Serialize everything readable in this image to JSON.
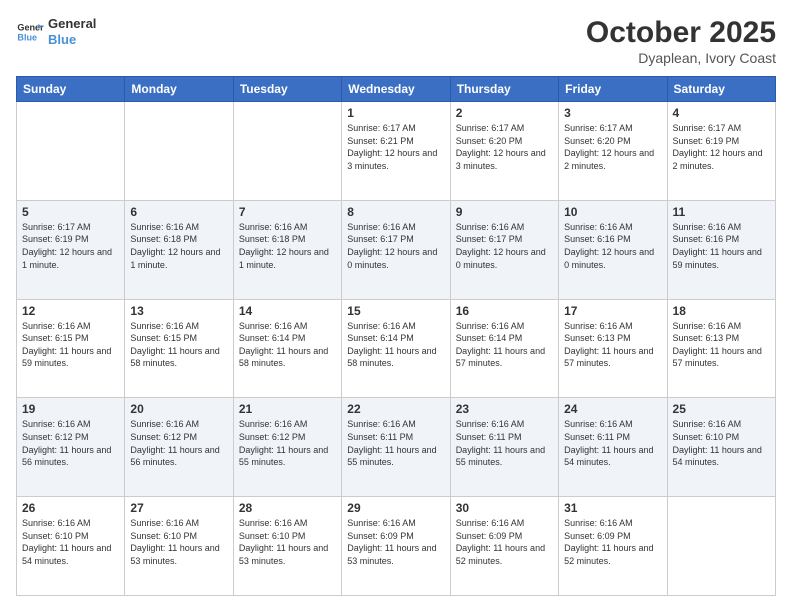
{
  "logo": {
    "line1": "General",
    "line2": "Blue"
  },
  "title": "October 2025",
  "location": "Dyaplean, Ivory Coast",
  "weekdays": [
    "Sunday",
    "Monday",
    "Tuesday",
    "Wednesday",
    "Thursday",
    "Friday",
    "Saturday"
  ],
  "rows": [
    [
      {
        "day": "",
        "info": ""
      },
      {
        "day": "",
        "info": ""
      },
      {
        "day": "",
        "info": ""
      },
      {
        "day": "1",
        "info": "Sunrise: 6:17 AM\nSunset: 6:21 PM\nDaylight: 12 hours and 3 minutes."
      },
      {
        "day": "2",
        "info": "Sunrise: 6:17 AM\nSunset: 6:20 PM\nDaylight: 12 hours and 3 minutes."
      },
      {
        "day": "3",
        "info": "Sunrise: 6:17 AM\nSunset: 6:20 PM\nDaylight: 12 hours and 2 minutes."
      },
      {
        "day": "4",
        "info": "Sunrise: 6:17 AM\nSunset: 6:19 PM\nDaylight: 12 hours and 2 minutes."
      }
    ],
    [
      {
        "day": "5",
        "info": "Sunrise: 6:17 AM\nSunset: 6:19 PM\nDaylight: 12 hours and 1 minute."
      },
      {
        "day": "6",
        "info": "Sunrise: 6:16 AM\nSunset: 6:18 PM\nDaylight: 12 hours and 1 minute."
      },
      {
        "day": "7",
        "info": "Sunrise: 6:16 AM\nSunset: 6:18 PM\nDaylight: 12 hours and 1 minute."
      },
      {
        "day": "8",
        "info": "Sunrise: 6:16 AM\nSunset: 6:17 PM\nDaylight: 12 hours and 0 minutes."
      },
      {
        "day": "9",
        "info": "Sunrise: 6:16 AM\nSunset: 6:17 PM\nDaylight: 12 hours and 0 minutes."
      },
      {
        "day": "10",
        "info": "Sunrise: 6:16 AM\nSunset: 6:16 PM\nDaylight: 12 hours and 0 minutes."
      },
      {
        "day": "11",
        "info": "Sunrise: 6:16 AM\nSunset: 6:16 PM\nDaylight: 11 hours and 59 minutes."
      }
    ],
    [
      {
        "day": "12",
        "info": "Sunrise: 6:16 AM\nSunset: 6:15 PM\nDaylight: 11 hours and 59 minutes."
      },
      {
        "day": "13",
        "info": "Sunrise: 6:16 AM\nSunset: 6:15 PM\nDaylight: 11 hours and 58 minutes."
      },
      {
        "day": "14",
        "info": "Sunrise: 6:16 AM\nSunset: 6:14 PM\nDaylight: 11 hours and 58 minutes."
      },
      {
        "day": "15",
        "info": "Sunrise: 6:16 AM\nSunset: 6:14 PM\nDaylight: 11 hours and 58 minutes."
      },
      {
        "day": "16",
        "info": "Sunrise: 6:16 AM\nSunset: 6:14 PM\nDaylight: 11 hours and 57 minutes."
      },
      {
        "day": "17",
        "info": "Sunrise: 6:16 AM\nSunset: 6:13 PM\nDaylight: 11 hours and 57 minutes."
      },
      {
        "day": "18",
        "info": "Sunrise: 6:16 AM\nSunset: 6:13 PM\nDaylight: 11 hours and 57 minutes."
      }
    ],
    [
      {
        "day": "19",
        "info": "Sunrise: 6:16 AM\nSunset: 6:12 PM\nDaylight: 11 hours and 56 minutes."
      },
      {
        "day": "20",
        "info": "Sunrise: 6:16 AM\nSunset: 6:12 PM\nDaylight: 11 hours and 56 minutes."
      },
      {
        "day": "21",
        "info": "Sunrise: 6:16 AM\nSunset: 6:12 PM\nDaylight: 11 hours and 55 minutes."
      },
      {
        "day": "22",
        "info": "Sunrise: 6:16 AM\nSunset: 6:11 PM\nDaylight: 11 hours and 55 minutes."
      },
      {
        "day": "23",
        "info": "Sunrise: 6:16 AM\nSunset: 6:11 PM\nDaylight: 11 hours and 55 minutes."
      },
      {
        "day": "24",
        "info": "Sunrise: 6:16 AM\nSunset: 6:11 PM\nDaylight: 11 hours and 54 minutes."
      },
      {
        "day": "25",
        "info": "Sunrise: 6:16 AM\nSunset: 6:10 PM\nDaylight: 11 hours and 54 minutes."
      }
    ],
    [
      {
        "day": "26",
        "info": "Sunrise: 6:16 AM\nSunset: 6:10 PM\nDaylight: 11 hours and 54 minutes."
      },
      {
        "day": "27",
        "info": "Sunrise: 6:16 AM\nSunset: 6:10 PM\nDaylight: 11 hours and 53 minutes."
      },
      {
        "day": "28",
        "info": "Sunrise: 6:16 AM\nSunset: 6:10 PM\nDaylight: 11 hours and 53 minutes."
      },
      {
        "day": "29",
        "info": "Sunrise: 6:16 AM\nSunset: 6:09 PM\nDaylight: 11 hours and 53 minutes."
      },
      {
        "day": "30",
        "info": "Sunrise: 6:16 AM\nSunset: 6:09 PM\nDaylight: 11 hours and 52 minutes."
      },
      {
        "day": "31",
        "info": "Sunrise: 6:16 AM\nSunset: 6:09 PM\nDaylight: 11 hours and 52 minutes."
      },
      {
        "day": "",
        "info": ""
      }
    ]
  ]
}
